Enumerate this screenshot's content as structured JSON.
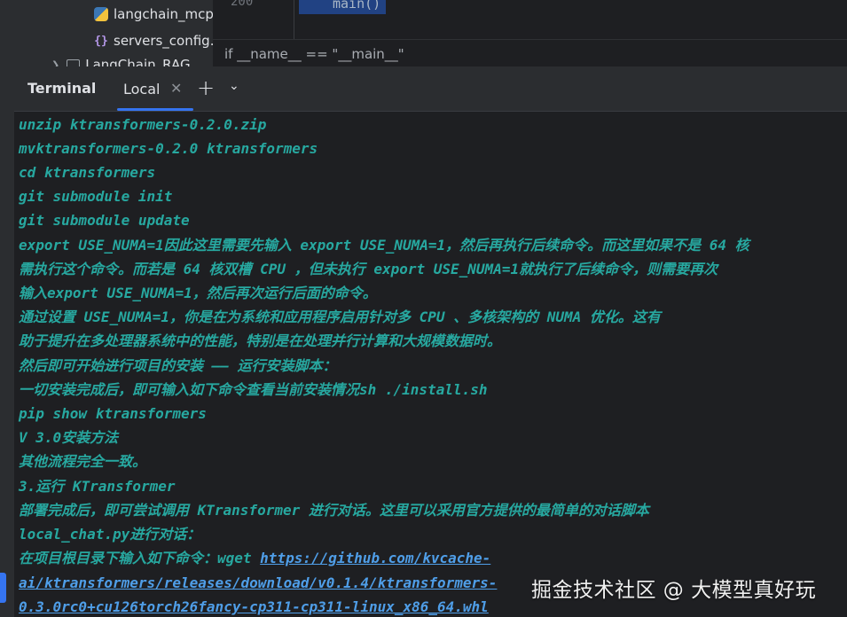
{
  "project_tree": {
    "items": [
      {
        "label": "langchain_mcp",
        "icon": "python-file-icon"
      },
      {
        "label": "servers_config.",
        "icon": "json-file-icon"
      },
      {
        "label": "LangChain_RAG",
        "icon": "folder-icon"
      }
    ]
  },
  "editor": {
    "line_number": "200",
    "selected_code": "main()",
    "breadcrumb": "if __name__ == \"__main__\""
  },
  "terminal": {
    "title": "Terminal",
    "tab_label": "Local",
    "lines": [
      "  unzip ktransformers-0.2.0.zip",
      "mvktransformers-0.2.0 ktransformers",
      "cd ktransformers",
      "git submodule init",
      "git submodule update",
      "export USE_NUMA=1因此这里需要先输入 export USE_NUMA=1，然后再执行后续命令。而这里如果不是 64 核",
      "需执行这个命令。而若是 64 核双槽 CPU ，但未执行 export USE_NUMA=1就执行了后续命令，则需要再次",
      "输入export USE_NUMA=1，然后再次运行后面的命令。",
      "通过设置  USE_NUMA=1，你是在为系统和应用程序启用针对多 CPU 、多核架构的 NUMA 优化。这有",
      "助于提升在多处理器系统中的性能，特别是在处理并行计算和大规模数据时。",
      "然后即可开始进行项目的安装 —— 运行安装脚本：",
      "一切安装完成后，即可输入如下命令查看当前安装情况sh ./install.sh",
      "pip show ktransformers",
      "V 3.0安装方法",
      "其他流程完全一致。",
      "3.运行 KTransformer",
      "部署完成后，即可尝试调用 KTransformer 进行对话。这里可以采用官方提供的最简单的对话脚本",
      "local_chat.py进行对话：",
      "在项目根目录下输入如下命令：wget "
    ],
    "link_parts": [
      "https://github.com/kvcache-",
      "ai/ktransformers/releases/download/v0.1.4/ktransformers-",
      "0.3.0rc0+cu126torch26fancy-cp311-cp311-linux_x86_64.whl"
    ]
  },
  "watermark": "掘金技术社区 @ 大模型真好玩",
  "colors": {
    "terminal_text": "#27a8a0",
    "link": "#4f9ee8",
    "accent": "#3574f0",
    "background": "#1e1f22"
  }
}
